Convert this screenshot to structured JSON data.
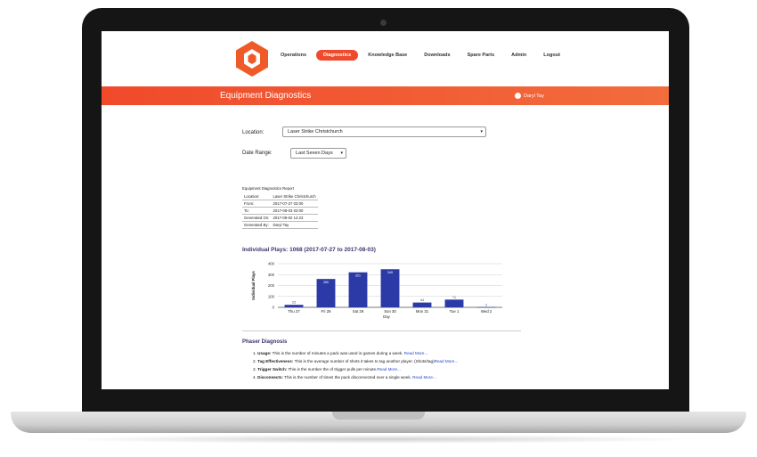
{
  "nav": {
    "items": [
      {
        "label": "Operations",
        "active": false
      },
      {
        "label": "Diagnostics",
        "active": true
      },
      {
        "label": "Knowledge Base",
        "active": false
      },
      {
        "label": "Downloads",
        "active": false
      },
      {
        "label": "Spare Parts",
        "active": false
      },
      {
        "label": "Admin",
        "active": false
      },
      {
        "label": "Logout",
        "active": false
      }
    ]
  },
  "banner": {
    "title": "Equipment Diagnostics",
    "user": "Daryl Tay"
  },
  "filters": {
    "location_label": "Location:",
    "location_value": "Laser Strike Christchurch",
    "date_range_label": "Date Range:",
    "date_range_value": "Last Seven Days"
  },
  "report": {
    "title": "Equipment Diagnostics Report",
    "rows": [
      {
        "key": "Location:",
        "value": "Laser Strike Christchurch"
      },
      {
        "key": "From:",
        "value": "2017-07-27 03:00"
      },
      {
        "key": "To:",
        "value": "2017-08-03 03:00"
      },
      {
        "key": "Generated On:",
        "value": "2017-08-02 14:23"
      },
      {
        "key": "Generated By:",
        "value": "Daryl Tay"
      }
    ]
  },
  "plays_title": "Individual Plays: 1068 (2017-07-27 to 2017-08-03)",
  "chart_data": {
    "type": "bar",
    "categories": [
      "Thu 27",
      "Fri 28",
      "Sat 29",
      "Sun 30",
      "Mon 31",
      "Tue 1",
      "Wed 2"
    ],
    "values": [
      23,
      260,
      321,
      349,
      44,
      71,
      2
    ],
    "xlabel": "Day",
    "ylabel": "Individual Plays",
    "ylim": [
      0,
      400
    ],
    "yticks": [
      0,
      100,
      200,
      300,
      400
    ],
    "color": "#2b3aa6"
  },
  "diagnosis": {
    "title": "Phaser Diagnosis",
    "items": [
      {
        "num": "1.",
        "term": "Usage:",
        "text": " This is the number of minutes a pack was used in games during a week. ",
        "link": "Read More..."
      },
      {
        "num": "2.",
        "term": "Tag Effectiveness:",
        "text": " This is the average number of shots it takes to tag another player. (Shots/tag)",
        "link": "Read More..."
      },
      {
        "num": "3.",
        "term": "Trigger Switch:",
        "text": " This is the number the of trigger pulls per minute.",
        "link": "Read More..."
      },
      {
        "num": "4.",
        "term": "Disconnects:",
        "text": " This is the number of times the pack disconnected over a single week. ",
        "link": "Read More..."
      }
    ]
  },
  "colors": {
    "accent": "#ef4a2b",
    "heading": "#3b3470",
    "link": "#2a46c6"
  }
}
